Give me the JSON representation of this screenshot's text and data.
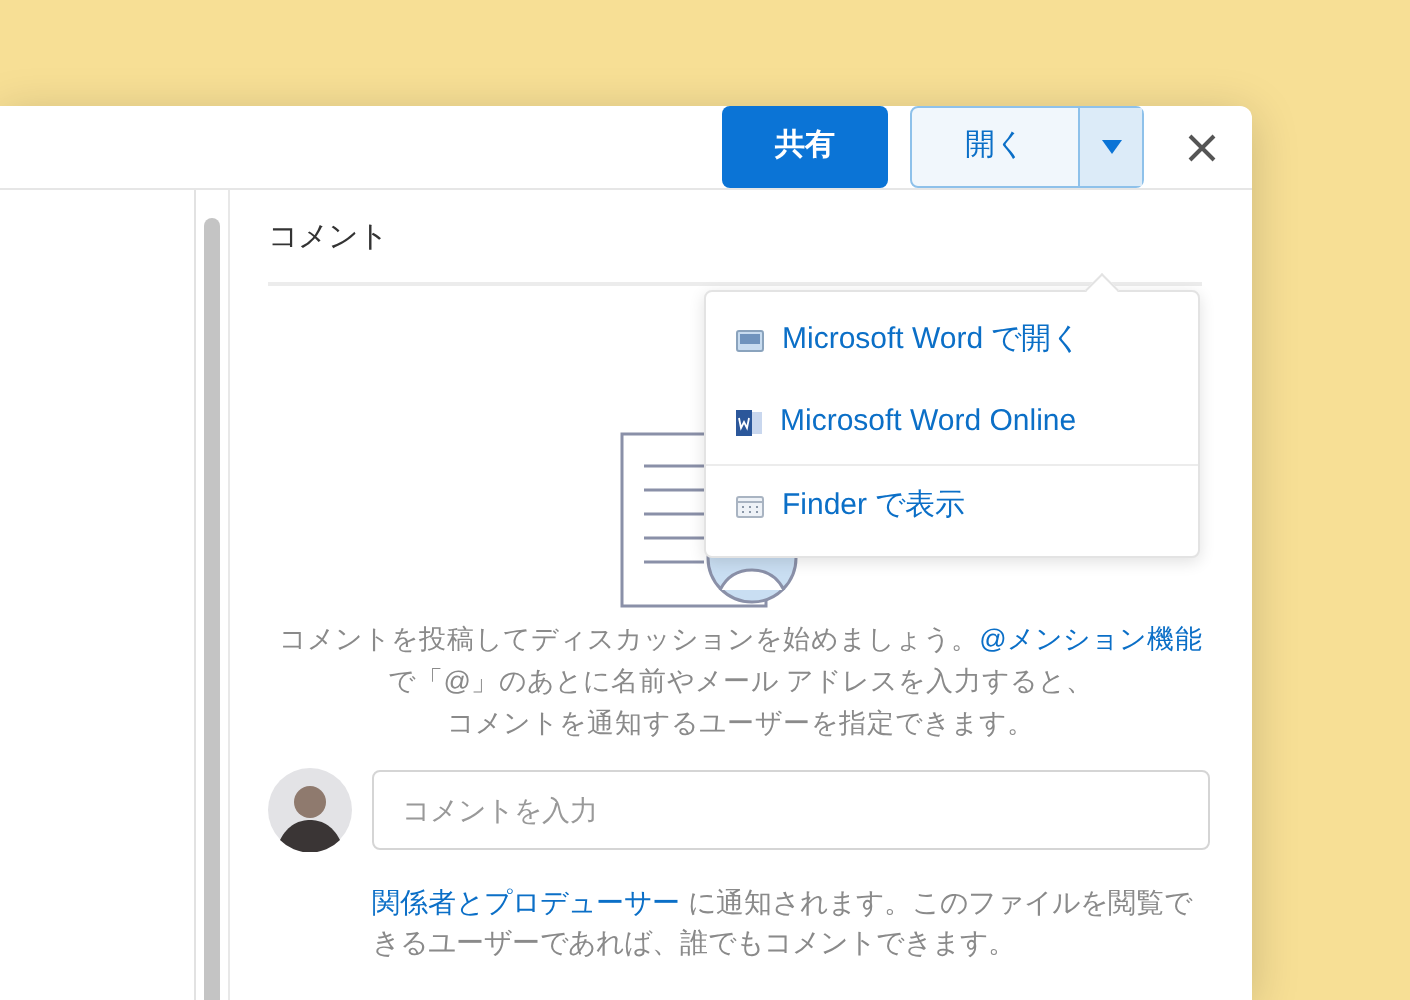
{
  "header": {
    "share_button": "共有",
    "open_button": "開く",
    "dropdown_expanded": true
  },
  "open_menu": [
    {
      "kind": "desktop",
      "label": "Microsoft Word で開く"
    },
    {
      "kind": "word",
      "label": "Microsoft Word Online"
    },
    {
      "kind": "finder",
      "label": "Finder で表示"
    }
  ],
  "comments": {
    "title": "コメント",
    "intro": {
      "lines": [
        {
          "text": "コメントを投稿してディスカッションを始めましょう。",
          "link": "@メンション機能"
        },
        {
          "text": "で「@」のあとに名前やメール アドレスを入力すると、"
        },
        {
          "text": "コメントを通知するユーザーを指定できます。"
        }
      ]
    },
    "input": {
      "placeholder": "コメントを入力"
    },
    "notice": {
      "link": "関係者とプロデューサー",
      "text": " に通知されます。このファイルを閲覧できるユーザーであれば、誰でもコメントできます。"
    }
  }
}
